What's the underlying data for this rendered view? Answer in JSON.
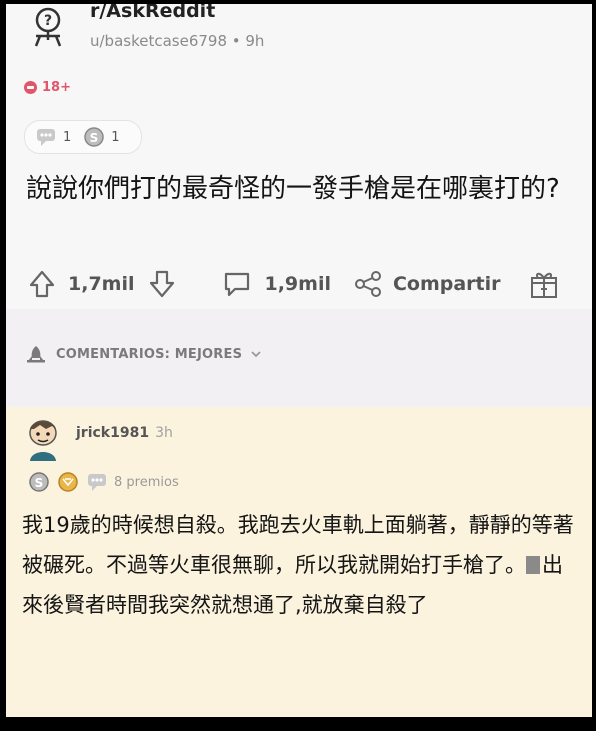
{
  "post": {
    "subreddit": "r/AskReddit",
    "meta": "u/basketcase6798 • 9h",
    "nsfw_label": "18+",
    "award_counts": [
      "1",
      "1"
    ],
    "title": "說說你們打的最奇怪的一發手槍是在哪裏打的?"
  },
  "actions": {
    "upvotes": "1,7mil",
    "comments": "1,9mil",
    "share": "Compartir"
  },
  "comments_header": {
    "sort_label": "COMENTARIOS: MEJORES"
  },
  "comment": {
    "username": "jrick1981",
    "time": "3h",
    "awards_label": "8 premios",
    "body_before": "我19歲的時候想自殺。我跑去火車軌上面躺著，靜靜的等著被碾死。不過等火車很無聊，所以我就開始打手槍了。",
    "body_after": "出來後賢者時間我突然就想通了,就放棄自殺了"
  },
  "colors": {
    "nsfw": "#e0566b",
    "comment_bg": "#fbf3de",
    "sort_bg": "#f3f0f4"
  }
}
